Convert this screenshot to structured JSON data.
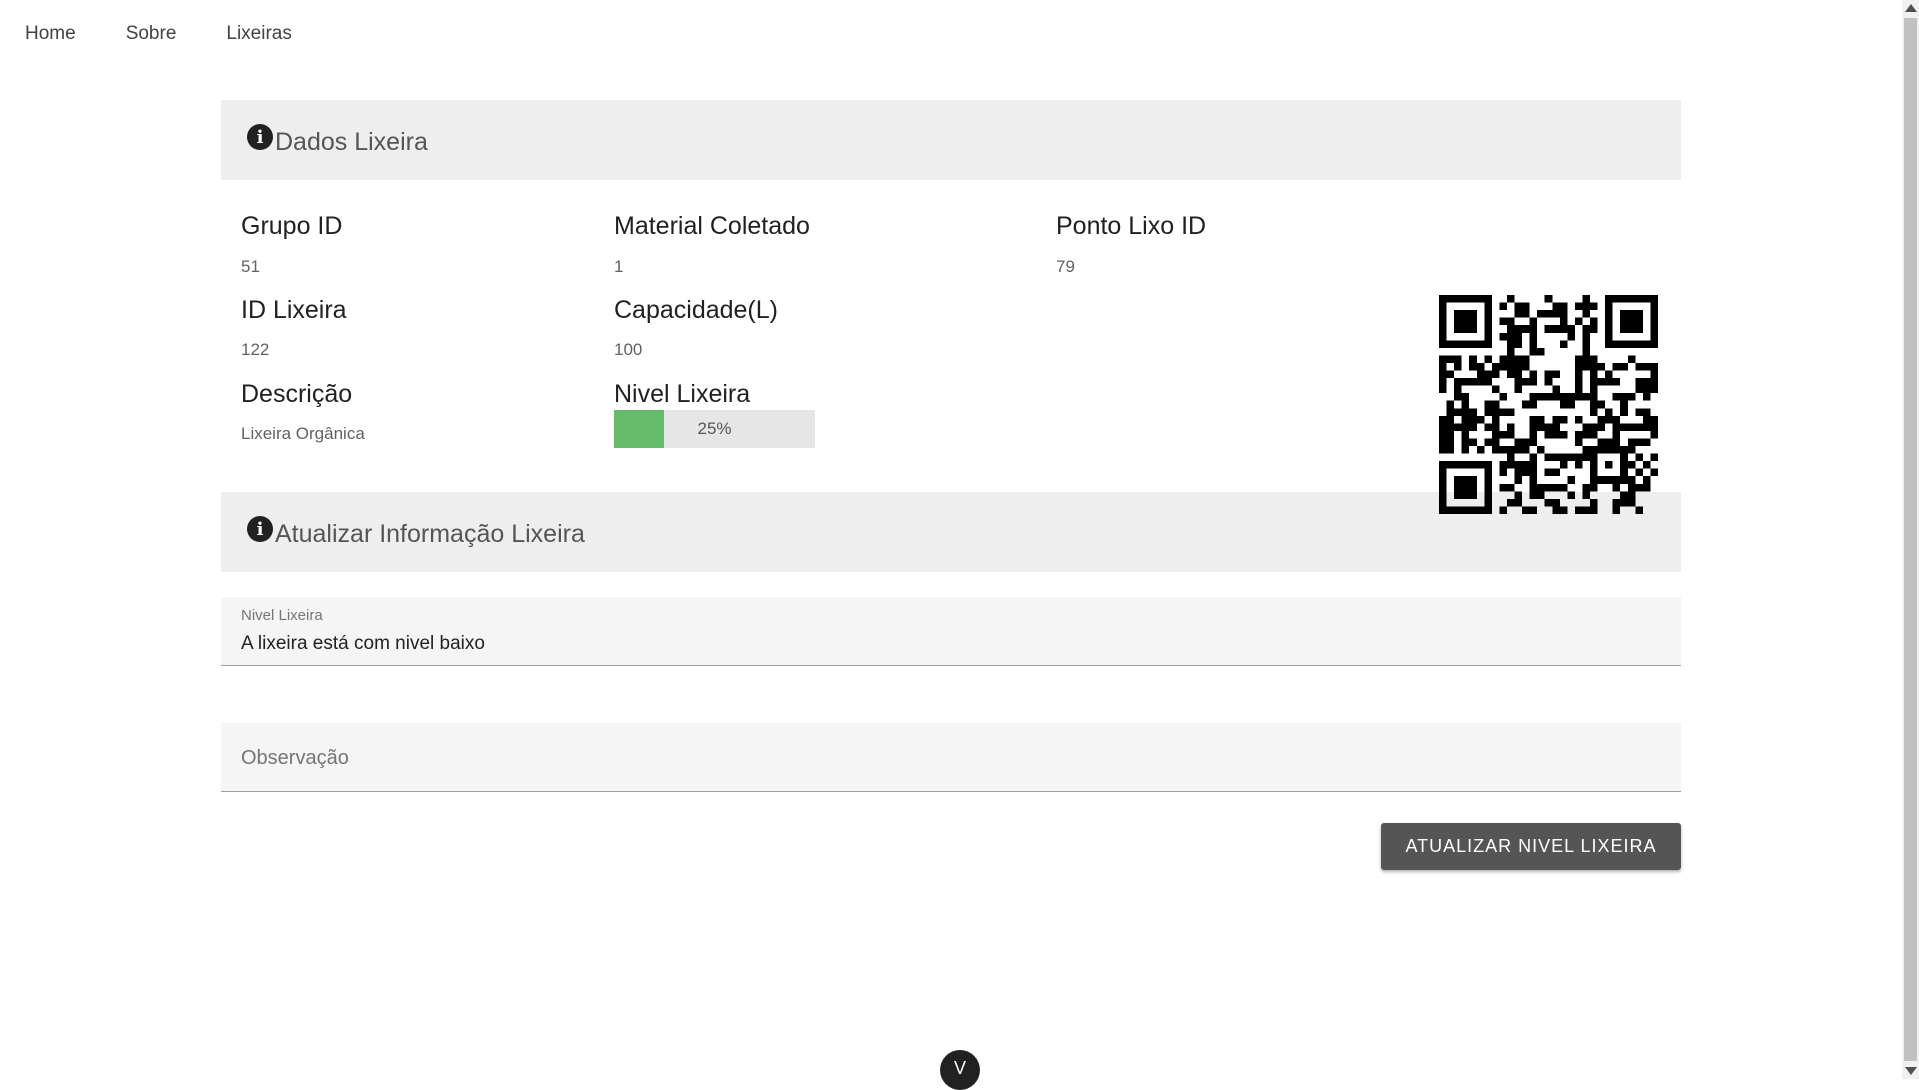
{
  "nav": {
    "items": [
      "Home",
      "Sobre",
      "Lixeiras"
    ]
  },
  "dados": {
    "header": "Dados Lixeira",
    "grupo_label": "Grupo ID",
    "grupo_value": "51",
    "material_label": "Material Coletado",
    "material_value": "1",
    "ponto_label": "Ponto Lixo ID",
    "ponto_value": "79",
    "id_label": "ID Lixeira",
    "id_value": "122",
    "capacidade_label": "Capacidade(L)",
    "capacidade_value": "100",
    "descricao_label": "Descrição",
    "descricao_value": "Lixeira Orgânica",
    "nivel_label": "Nivel Lixeira",
    "nivel_percent": 25,
    "nivel_text": "25%"
  },
  "atualizar": {
    "header": "Atualizar Informação Lixeira",
    "nivel_field_label": "Nivel Lixeira",
    "nivel_field_value": "A lixeira está com nivel baixo",
    "observacao_placeholder": "Observação",
    "button_label": "ATUALIZAR NIVEL LIXEIRA"
  },
  "fab": {
    "icon": "chevron-down-icon",
    "label": "V"
  },
  "colors": {
    "progress_fill": "#66bb6a",
    "button_bg": "#555555",
    "header_bg": "#eeeeee"
  },
  "icons": {
    "info": "info-icon",
    "qr": "qr-code-icon"
  }
}
